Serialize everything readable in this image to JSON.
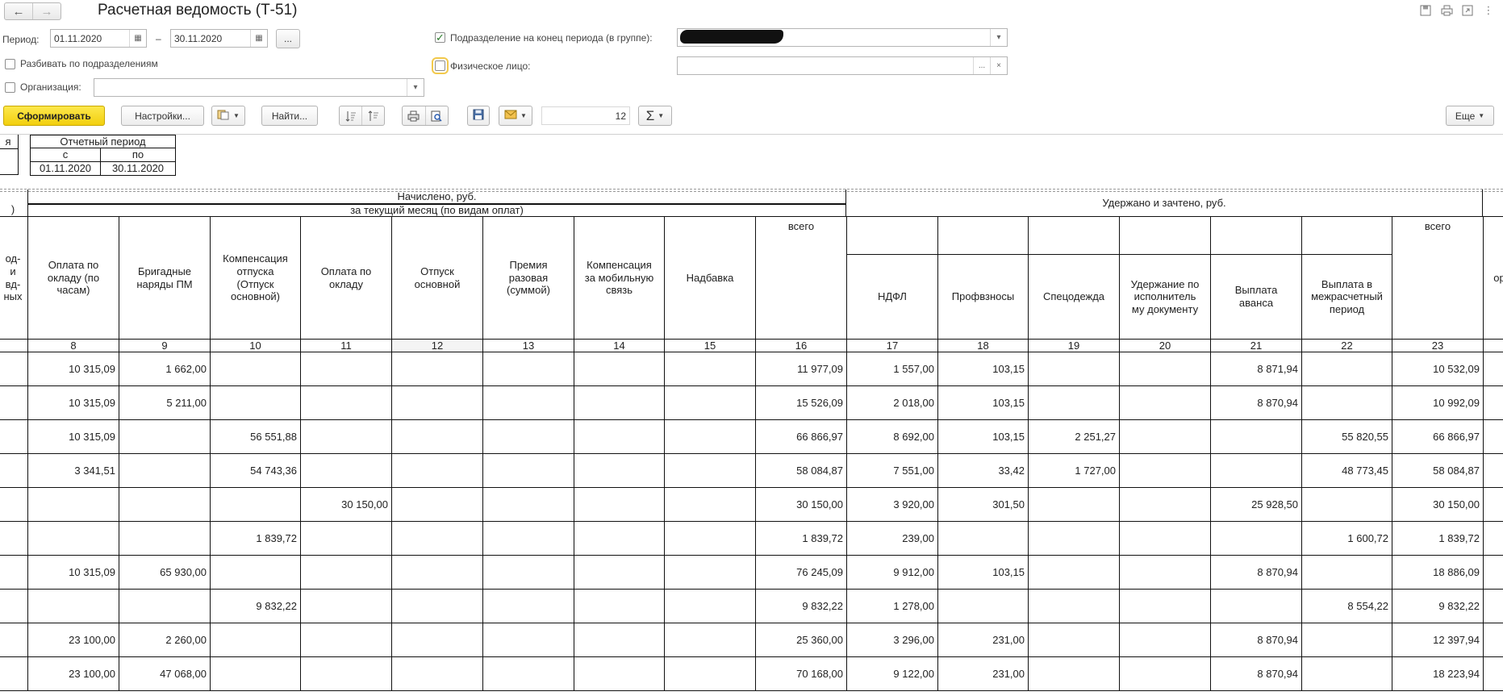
{
  "window": {
    "title": "Расчетная ведомость (Т-51)",
    "nav_back_icon": "←",
    "nav_forward_icon": "→",
    "top_icons": [
      "save-icon",
      "print-icon",
      "link-icon",
      "more-icon"
    ]
  },
  "filters": {
    "period_label": "Период:",
    "period_from": "01.11.2020",
    "period_to": "30.11.2020",
    "period_dash": "–",
    "ellipsis": "...",
    "split_label": "Разбивать по подразделениям",
    "org_label": "Организация:",
    "subdivision_label": "Подразделение на конец периода (в группе):",
    "person_label": "Физическое лицо:",
    "clear_glyph": "×",
    "dropdown_glyph": "▾"
  },
  "toolbar": {
    "generate_label": "Сформировать",
    "settings_label": "Настройки...",
    "find_label": "Найти...",
    "font_size_value": "12",
    "sigma": "Σ",
    "more_label": "Еще"
  },
  "report": {
    "period_header": "Отчетный период",
    "from_label": "с",
    "to_label": "по",
    "from_value": "01.11.2020",
    "to_value": "30.11.2020",
    "left_stub_top": "я",
    "left_stub_mid": ")",
    "left_stub_col": "од-\nи\nвд-\nных",
    "right_stub_col": "ор",
    "accrued_header": "Начислено, руб.",
    "accrued_sub_header": "за текущий месяц (по видам оплат)",
    "withheld_header": "Удержано и зачтено, руб.",
    "columns": [
      {
        "label": "Оплата по\nокладу (по\nчасам)",
        "num": "8"
      },
      {
        "label": "Бригадные\nнаряды ПМ",
        "num": "9"
      },
      {
        "label": "Компенсация\nотпуска\n(Отпуск\nосновной)",
        "num": "10"
      },
      {
        "label": "Оплата по\nокладу",
        "num": "11"
      },
      {
        "label": "Отпуск\nосновной",
        "num": "12"
      },
      {
        "label": "Премия\nразовая\n(суммой)",
        "num": "13"
      },
      {
        "label": "Компенсация\nза мобильную\nсвязь",
        "num": "14"
      },
      {
        "label": "Надбавка",
        "num": "15"
      },
      {
        "label": "всего",
        "num": "16"
      },
      {
        "label": "НДФЛ",
        "num": "17"
      },
      {
        "label": "Профвзносы",
        "num": "18"
      },
      {
        "label": "Спецодежда",
        "num": "19"
      },
      {
        "label": "Удержание по\nисполнитель\nму документу",
        "num": "20"
      },
      {
        "label": "Выплата\nаванса",
        "num": "21"
      },
      {
        "label": "Выплата в\nмежрасчетный\nпериод",
        "num": "22"
      },
      {
        "label": "всего",
        "num": "23"
      }
    ],
    "rows": [
      [
        "10 315,09",
        "1 662,00",
        "",
        "",
        "",
        "",
        "",
        "",
        "11 977,09",
        "1 557,00",
        "103,15",
        "",
        "",
        "8 871,94",
        "",
        "10 532,09"
      ],
      [
        "10 315,09",
        "5 211,00",
        "",
        "",
        "",
        "",
        "",
        "",
        "15 526,09",
        "2 018,00",
        "103,15",
        "",
        "",
        "8 870,94",
        "",
        "10 992,09"
      ],
      [
        "10 315,09",
        "",
        "56 551,88",
        "",
        "",
        "",
        "",
        "",
        "66 866,97",
        "8 692,00",
        "103,15",
        "2 251,27",
        "",
        "",
        "55 820,55",
        "66 866,97"
      ],
      [
        "3 341,51",
        "",
        "54 743,36",
        "",
        "",
        "",
        "",
        "",
        "58 084,87",
        "7 551,00",
        "33,42",
        "1 727,00",
        "",
        "",
        "48 773,45",
        "58 084,87"
      ],
      [
        "",
        "",
        "",
        "30 150,00",
        "",
        "",
        "",
        "",
        "30 150,00",
        "3 920,00",
        "301,50",
        "",
        "",
        "25 928,50",
        "",
        "30 150,00"
      ],
      [
        "",
        "",
        "1 839,72",
        "",
        "",
        "",
        "",
        "",
        "1 839,72",
        "239,00",
        "",
        "",
        "",
        "",
        "1 600,72",
        "1 839,72"
      ],
      [
        "10 315,09",
        "65 930,00",
        "",
        "",
        "",
        "",
        "",
        "",
        "76 245,09",
        "9 912,00",
        "103,15",
        "",
        "",
        "8 870,94",
        "",
        "18 886,09"
      ],
      [
        "",
        "",
        "9 832,22",
        "",
        "",
        "",
        "",
        "",
        "9 832,22",
        "1 278,00",
        "",
        "",
        "",
        "",
        "8 554,22",
        "9 832,22"
      ],
      [
        "23 100,00",
        "2 260,00",
        "",
        "",
        "",
        "",
        "",
        "",
        "25 360,00",
        "3 296,00",
        "231,00",
        "",
        "",
        "8 870,94",
        "",
        "12 397,94"
      ],
      [
        "23 100,00",
        "47 068,00",
        "",
        "",
        "",
        "",
        "",
        "",
        "70 168,00",
        "9 122,00",
        "231,00",
        "",
        "",
        "8 870,94",
        "",
        "18 223,94"
      ]
    ]
  },
  "colors": {
    "primary_button": "#f5d320",
    "grid_line": "#111111",
    "dashed_line": "#9a9a9a"
  }
}
